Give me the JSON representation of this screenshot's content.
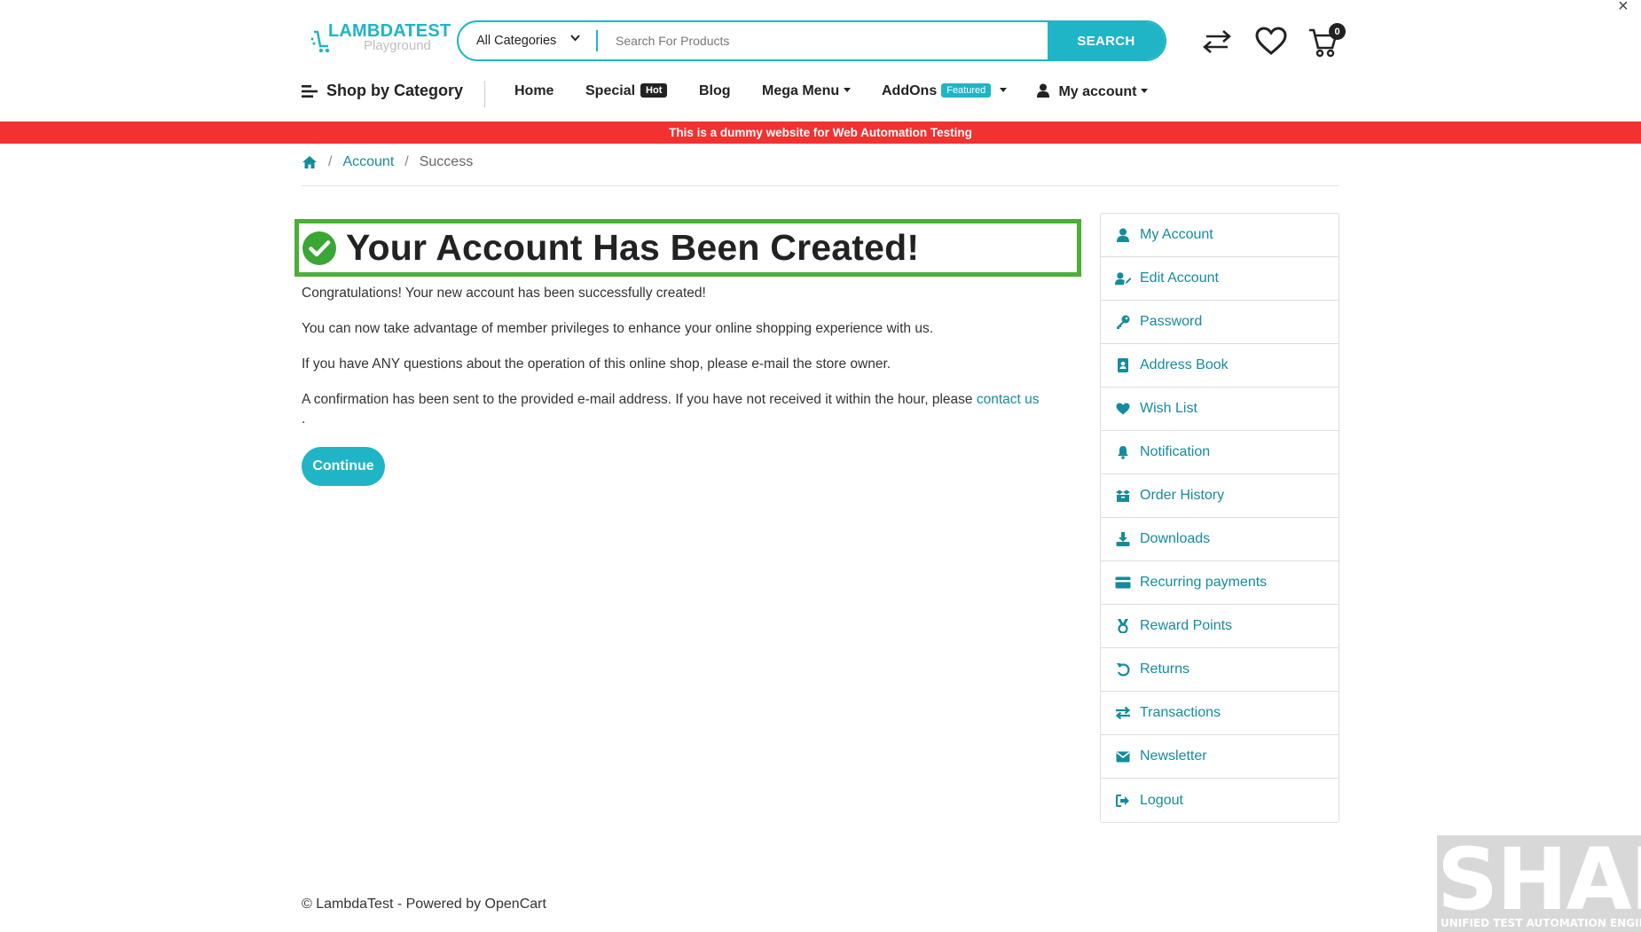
{
  "header": {
    "logo_brand": "LAMBDATEST",
    "logo_sub": "Playground",
    "search": {
      "category": "All Categories",
      "placeholder": "Search For Products",
      "button": "SEARCH"
    },
    "cart_count": "0"
  },
  "nav": {
    "shop_by_category": "Shop by Category",
    "items": [
      {
        "label": "Home"
      },
      {
        "label": "Special",
        "badge": "Hot"
      },
      {
        "label": "Blog"
      },
      {
        "label": "Mega Menu"
      },
      {
        "label": "AddOns",
        "badge": "Featured"
      },
      {
        "label": "My account"
      }
    ]
  },
  "banner": "This is a dummy website for Web Automation Testing",
  "breadcrumb": [
    "Account",
    "Success"
  ],
  "main": {
    "title": "Your Account Has Been Created!",
    "p1": "Congratulations! Your new account has been successfully created!",
    "p2": "You can now take advantage of member privileges to enhance your online shopping experience with us.",
    "p3": "If you have ANY questions about the operation of this online shop, please e-mail the store owner.",
    "p4": "A confirmation has been sent to the provided e-mail address. If you have not received it within the hour, please",
    "p4_link": "contact us",
    "p4_end": ".",
    "continue": "Continue"
  },
  "sidebar": {
    "items": [
      {
        "label": "My Account",
        "icon": "user-icon"
      },
      {
        "label": "Edit Account",
        "icon": "user-edit-icon"
      },
      {
        "label": "Password",
        "icon": "key-icon"
      },
      {
        "label": "Address Book",
        "icon": "address-book-icon"
      },
      {
        "label": "Wish List",
        "icon": "heart-icon"
      },
      {
        "label": "Notification",
        "icon": "bell-icon"
      },
      {
        "label": "Order History",
        "icon": "boxes-icon"
      },
      {
        "label": "Downloads",
        "icon": "download-icon"
      },
      {
        "label": "Recurring payments",
        "icon": "credit-card-icon"
      },
      {
        "label": "Reward Points",
        "icon": "medal-icon"
      },
      {
        "label": "Returns",
        "icon": "undo-icon"
      },
      {
        "label": "Transactions",
        "icon": "exchange-icon"
      },
      {
        "label": "Newsletter",
        "icon": "envelope-icon"
      },
      {
        "label": "Logout",
        "icon": "sign-out-icon"
      }
    ]
  },
  "footer": "© LambdaTest - Powered by OpenCart",
  "watermark": {
    "big": "SHAFT",
    "small": "UNIFIED TEST AUTOMATION ENGINE"
  },
  "colors": {
    "accent": "#1fb4c6",
    "link": "#158b9e",
    "banner": "#f23131",
    "success_border": "#4caf37",
    "success_icon": "#3aa635"
  }
}
